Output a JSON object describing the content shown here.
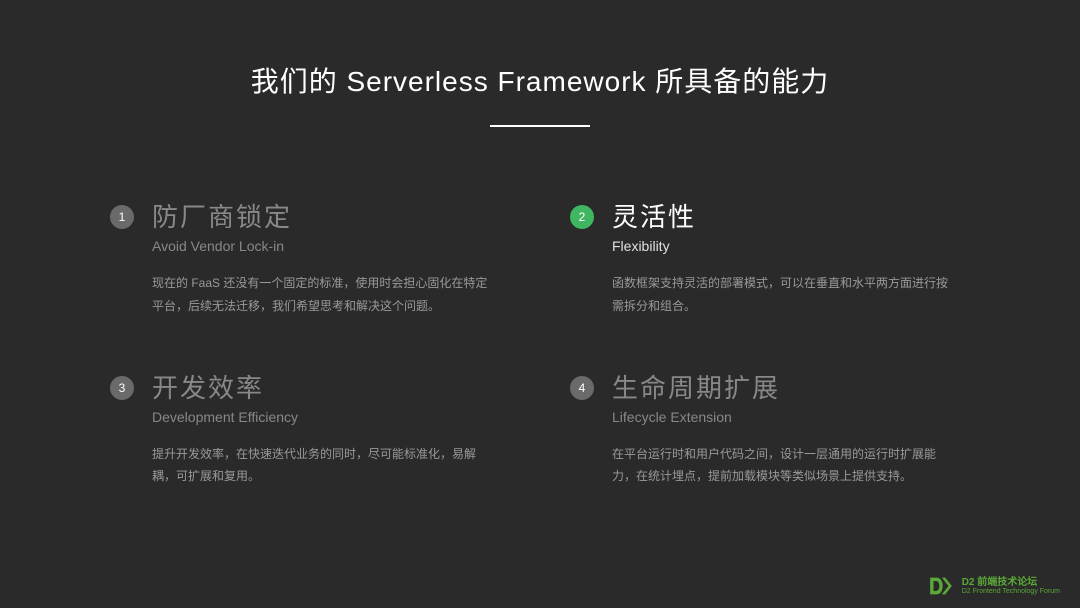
{
  "title": "我们的 Serverless Framework  所具备的能力",
  "items": [
    {
      "num": "1",
      "title_cn": "防厂商锁定",
      "title_en": "Avoid Vendor Lock-in",
      "desc": "现在的 FaaS 还没有一个固定的标准，使用时会担心固化在特定平台，后续无法迁移，我们希望思考和解决这个问题。",
      "highlighted": false
    },
    {
      "num": "2",
      "title_cn": "灵活性",
      "title_en": "Flexibility",
      "desc": "函数框架支持灵活的部署模式，可以在垂直和水平两方面进行按需拆分和组合。",
      "highlighted": true
    },
    {
      "num": "3",
      "title_cn": "开发效率",
      "title_en": "Development Efficiency",
      "desc": "提升开发效率，在快速迭代业务的同时，尽可能标准化，易解耦，可扩展和复用。",
      "highlighted": false
    },
    {
      "num": "4",
      "title_cn": "生命周期扩展",
      "title_en": "Lifecycle Extension",
      "desc": "在平台运行时和用户代码之间，设计一层通用的运行时扩展能力，在统计埋点，提前加载模块等类似场景上提供支持。",
      "highlighted": false
    }
  ],
  "footer": {
    "title": "D2 前端技术论坛",
    "sub": "D2 Frontend Technology Forum"
  }
}
